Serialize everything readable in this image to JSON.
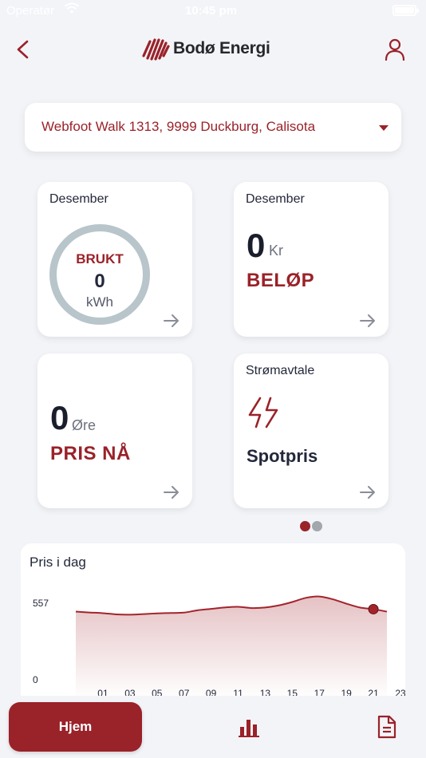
{
  "status_bar": {
    "carrier": "Operatør",
    "time": "10:45 pm"
  },
  "header": {
    "brand": "Bodø Energi",
    "back_icon": "chevron-left-icon",
    "profile_icon": "user-icon"
  },
  "address": {
    "value": "Webfoot Walk 1313, 9999 Duckburg, Calisota",
    "icon": "caret-down-icon"
  },
  "cards": {
    "usage": {
      "label": "Desember",
      "ring_title": "BRUKT",
      "value": "0",
      "unit": "kWh"
    },
    "amount": {
      "label": "Desember",
      "value": "0",
      "unit": "Kr",
      "title": "BELØP"
    },
    "price_now": {
      "value": "0",
      "unit": "Øre",
      "title": "PRIS NÅ"
    },
    "contract": {
      "label": "Strømavtale",
      "plan": "Spotpris",
      "icon": "lightning-bolt-icon"
    }
  },
  "pager": {
    "pages": 2,
    "active": 0
  },
  "chart_title": "Pris i dag",
  "chart_data": {
    "type": "area",
    "title": "Pris i dag",
    "ylim": [
      0,
      557
    ],
    "y_ticks": [
      "0",
      "557"
    ],
    "x_ticks": [
      "01",
      "03",
      "05",
      "07",
      "09",
      "11",
      "13",
      "15",
      "17",
      "19",
      "21",
      "23"
    ],
    "x": [
      0,
      1,
      2,
      3,
      4,
      5,
      6,
      7,
      8,
      9,
      10,
      11,
      12,
      13,
      14,
      15,
      16,
      17,
      18,
      19,
      20,
      21,
      22,
      23
    ],
    "values": [
      490,
      484,
      479,
      470,
      468,
      472,
      477,
      480,
      483,
      500,
      510,
      520,
      525,
      516,
      520,
      535,
      560,
      590,
      600,
      580,
      548,
      520,
      508,
      490
    ],
    "current_hour": 22,
    "grid": false,
    "colors": {
      "line": "#a3242d",
      "fill": "#a3242d"
    }
  },
  "tabbar": {
    "home": "Hjem",
    "stats_icon": "bar-chart-icon",
    "docs_icon": "document-icon"
  },
  "colors": {
    "accent": "#9a2229",
    "background": "#f3f4f8",
    "ring": "#b8c5ca"
  }
}
